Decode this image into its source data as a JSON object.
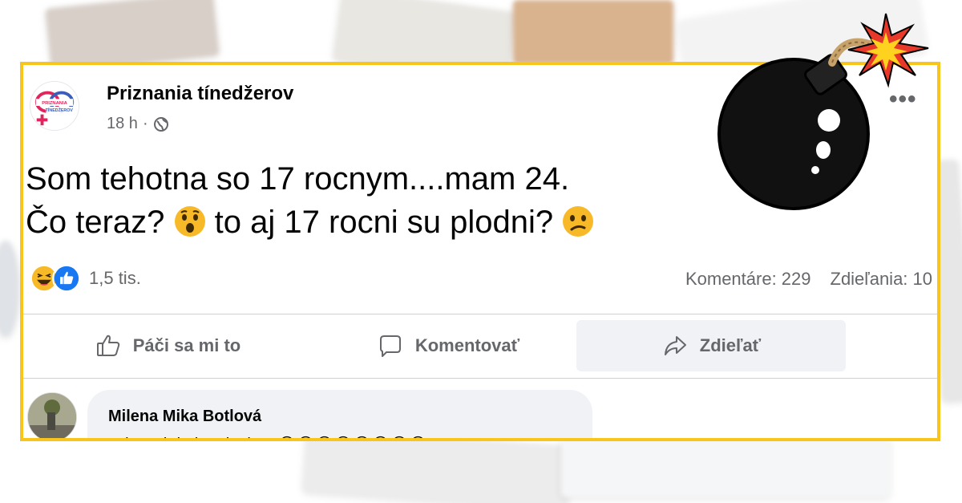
{
  "post": {
    "page_name": "Priznania tínedžerov",
    "avatar_text": "PRIZNANIA TÍNEDŽEROV",
    "time": "18 h",
    "separator": "·",
    "text_line1": "Som tehotna so 17 rocnym....mam 24.",
    "text_line2a": "Čo teraz?",
    "text_line2b": "to aj 17 rocni su plodni?",
    "reaction_count": "1,5 tis.",
    "comments_count": "Komentáre: 229",
    "shares_count": "Zdieľania: 10",
    "like_label": "Páči sa mi to",
    "comment_label": "Komentovať",
    "share_label": "Zdieľať",
    "more_label": "•••"
  },
  "comment": {
    "author": "Milena Mika Botlová",
    "text": "Tak tu si riadne rieglo... 😂😂😂😂😂😂😂😂"
  },
  "icons": {
    "globe": "globe-icon",
    "more": "more-icon",
    "like": "thumbs-up-icon",
    "comment": "speech-bubble-icon",
    "share": "share-arrow-icon",
    "reaction_haha": "haha-reaction-icon",
    "reaction_like": "like-reaction-icon",
    "emoji_surprised": "surprised-emoji-icon",
    "emoji_confused": "confused-emoji-icon",
    "bomb": "bomb-icon"
  },
  "colors": {
    "frame": "#f7c51b",
    "facebook_blue": "#1877f2",
    "secondary_text": "#65676b",
    "bubble": "#f0f2f5"
  }
}
